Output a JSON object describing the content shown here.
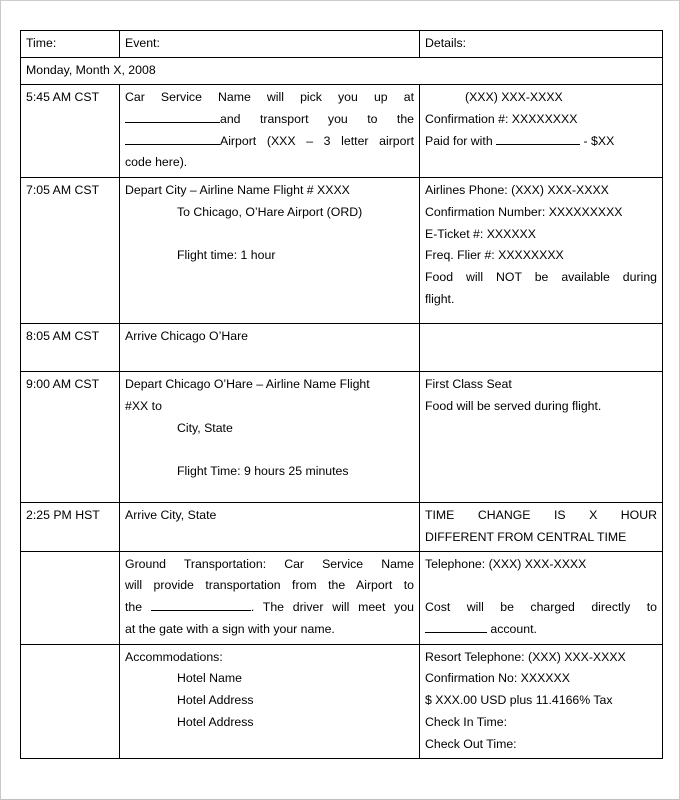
{
  "document": {
    "type": "travel-itinerary-table",
    "columns": [
      "Time:",
      "Event:",
      "Details:"
    ],
    "date_row": "Monday, Month X, 2008"
  },
  "rows": [
    {
      "time": "5:45 AM CST",
      "event": {
        "l1": "Car Service Name will pick you up at",
        "l2": "and transport you to the",
        "l3": "Airport (XXX – 3 letter airport",
        "l4": "code here)."
      },
      "details": {
        "l1": "(XXX) XXX-XXXX",
        "l2": "Confirmation #: XXXXXXXX",
        "l3a": "Paid for with ",
        "l3b": " - $XX"
      }
    },
    {
      "time": "7:05 AM CST",
      "event": {
        "l1": "Depart City – Airline Name Flight # XXXX",
        "l2": "To Chicago, O’Hare Airport (ORD)",
        "l3": "Flight time: 1 hour"
      },
      "details": {
        "l1": "Airlines Phone: (XXX) XXX-XXXX",
        "l2": "Confirmation Number: XXXXXXXXX",
        "l3": "E-Ticket #: XXXXXX",
        "l4": "Freq. Flier #: XXXXXXXX",
        "l5": "Food will NOT be available during",
        "l6": "flight."
      }
    },
    {
      "time": "8:05 AM CST",
      "event": {
        "l1": "Arrive Chicago O’Hare"
      },
      "details": {}
    },
    {
      "time": "9:00 AM CST",
      "event": {
        "l1": "Depart Chicago O’Hare – Airline Name Flight",
        "l2": "#XX to",
        "l3": "City, State",
        "l4": "Flight Time: 9 hours 25 minutes"
      },
      "details": {
        "l1": "First Class Seat",
        "l2": "Food will be served during flight."
      }
    },
    {
      "time": "2:25 PM HST",
      "event": {
        "l1": "Arrive City, State"
      },
      "details": {
        "l1": "TIME CHANGE IS X HOUR",
        "l2": "DIFFERENT FROM CENTRAL TIME"
      }
    },
    {
      "time": "",
      "event": {
        "l1": "Ground Transportation:   Car Service Name",
        "l2": "will provide transportation from the Airport to",
        "l3a": "the ",
        "l3b": ".  The driver will meet you",
        "l4": "at the gate with a sign with your name."
      },
      "details": {
        "l1": "Telephone:  (XXX) XXX-XXXX",
        "l2": "Cost will be charged directly to",
        "l3b": " account."
      }
    },
    {
      "time": "",
      "event": {
        "l1": "Accommodations:",
        "l2": "Hotel Name",
        "l3": "Hotel Address",
        "l4": "Hotel Address"
      },
      "details": {
        "l1": "Resort Telephone:  (XXX) XXX-XXXX",
        "l2": "Confirmation No:  XXXXXX",
        "l3": "$ XXX.00 USD plus 11.4166% Tax",
        "l4": "Check In Time:",
        "l5": "Check Out Time:"
      }
    }
  ]
}
